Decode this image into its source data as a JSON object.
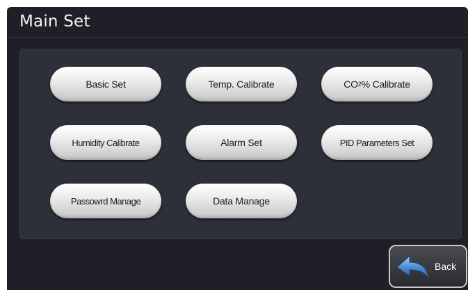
{
  "header": {
    "title": "Main Set"
  },
  "menu": {
    "basic_set": "Basic Set",
    "temp_calibrate": "Temp. Calibrate",
    "co2_calibrate_prefix": "CO",
    "co2_calibrate_sub": "2",
    "co2_calibrate_suffix": "% Calibrate",
    "humidity_calibrate": "Humidity Calibrate",
    "alarm_set": "Alarm Set",
    "pid_parameters_set": "PID Parameters Set",
    "password_manage": "Passowrd Manage",
    "data_manage": "Data Manage"
  },
  "footer": {
    "back_label": "Back"
  },
  "colors": {
    "screen_bg": "#1f2027",
    "panel_bg": "#2d2f39",
    "button_light": "#ffffff",
    "button_dark": "#bdbdbd",
    "back_arrow": "#4f8fd6"
  },
  "icons": {
    "back": "back-arrow-icon"
  }
}
